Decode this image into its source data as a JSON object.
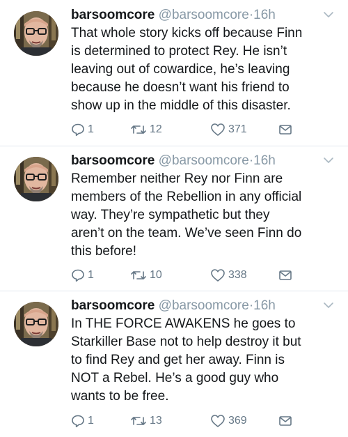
{
  "tweets": [
    {
      "name": "barsoomcore",
      "handle": "@barsoomcore",
      "dot": "·",
      "time": "16h",
      "text": "That whole story kicks off because Finn\nis determined to protect Rey. He isn’t\nleaving out of cowardice, he’s leaving\nbecause he doesn’t want his friend to\nshow up in the middle of this disaster.",
      "replies": "1",
      "retweets": "12",
      "likes": "371"
    },
    {
      "name": "barsoomcore",
      "handle": "@barsoomcore",
      "dot": "·",
      "time": "16h",
      "text": "Remember neither Rey nor Finn are\nmembers of the Rebellion in any official\nway. They’re sympathetic but they\naren’t on the team. We’ve seen Finn do\nthis before!",
      "replies": "1",
      "retweets": "10",
      "likes": "338"
    },
    {
      "name": "barsoomcore",
      "handle": "@barsoomcore",
      "dot": "·",
      "time": "16h",
      "text": "In THE FORCE AWAKENS he goes to\nStarkiller Base not to help destroy it but\nto find Rey and get her away. Finn is\nNOT a Rebel. He’s a good guy who\nwants to be free.",
      "replies": "1",
      "retweets": "13",
      "likes": "369"
    }
  ],
  "icons": {
    "reply": "reply-icon",
    "retweet": "retweet-icon",
    "like": "heart-icon",
    "message": "envelope-icon",
    "caret": "chevron-down-icon"
  },
  "colors": {
    "icon_gray": "#657786",
    "meta_gray": "#8899a6",
    "text": "#14171a"
  }
}
